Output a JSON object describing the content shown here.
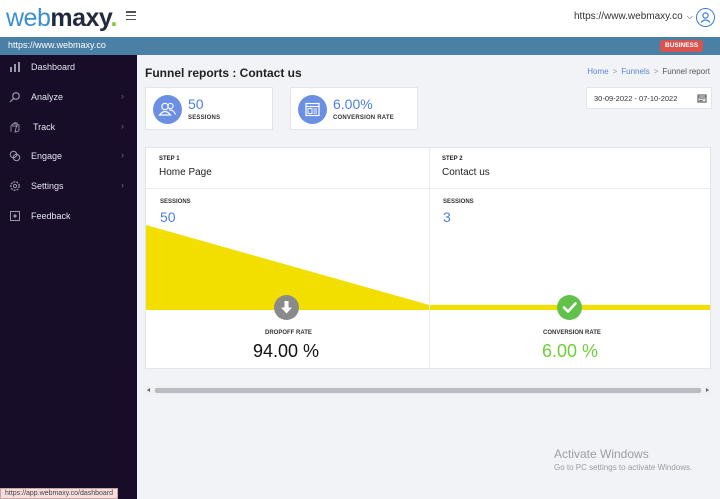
{
  "header": {
    "logo_web": "web",
    "logo_maxy": "maxy",
    "logo_dot": ".",
    "site_selector": "https://www.webmaxy.co",
    "icons": {
      "menu": "hamburger-icon",
      "dropdown": "chevron-down-icon",
      "user": "user-icon"
    }
  },
  "url_bar": {
    "url": "https://www.webmaxy.co",
    "badge": "BUSINESS",
    "badge_color": "#d9534f"
  },
  "sidebar": {
    "items": [
      {
        "label": "Dashboard",
        "icon": "bar-chart-icon",
        "has_arrow": false
      },
      {
        "label": "Analyze",
        "icon": "search-icon",
        "has_arrow": true
      },
      {
        "label": "Track",
        "icon": "hand-icon",
        "has_arrow": true
      },
      {
        "label": "Engage",
        "icon": "engage-icon",
        "has_arrow": true
      },
      {
        "label": "Settings",
        "icon": "gear-icon",
        "has_arrow": true
      },
      {
        "label": "Feedback",
        "icon": "feedback-icon",
        "has_arrow": false
      }
    ],
    "status_url": "https://app.webmaxy.co/dashboard"
  },
  "main": {
    "title": "Funnel reports : Contact us",
    "breadcrumb": {
      "home": "Home",
      "funnels": "Funnels",
      "current": "Funnel report",
      "separator": ">"
    },
    "stats": [
      {
        "value": "50",
        "caption": "SESSIONS",
        "icon": "users-icon"
      },
      {
        "value": "6.00%",
        "caption": "CONVERSION RATE",
        "icon": "browser-icon"
      }
    ],
    "date_range": "30-09-2022 - 07-10-2022",
    "date_icon": "calendar-icon"
  },
  "funnel": {
    "steps": [
      {
        "step_label": "STEP 1",
        "name": "Home Page",
        "sessions_label": "SESSIONS",
        "sessions": "50",
        "sessions_value": 50,
        "rate_label": "DROPOFF RATE",
        "rate": "94.00 %",
        "rate_icon": "arrow-down-icon"
      },
      {
        "step_label": "STEP 2",
        "name": "Contact us",
        "sessions_label": "SESSIONS",
        "sessions": "3",
        "sessions_value": 3,
        "rate_label": "CONVERSION RATE",
        "rate": "6.00 %",
        "rate_icon": "check-icon"
      }
    ],
    "colors": {
      "fill": "#f2df00",
      "dropoff_icon": "#8a8a8a",
      "conversion_icon": "#62c14b",
      "conversion_text": "#6fcf3b",
      "dropoff_text": "#111111"
    }
  },
  "watermark": {
    "line1": "Activate Windows",
    "line2": "Go to PC settings to activate Windows."
  }
}
